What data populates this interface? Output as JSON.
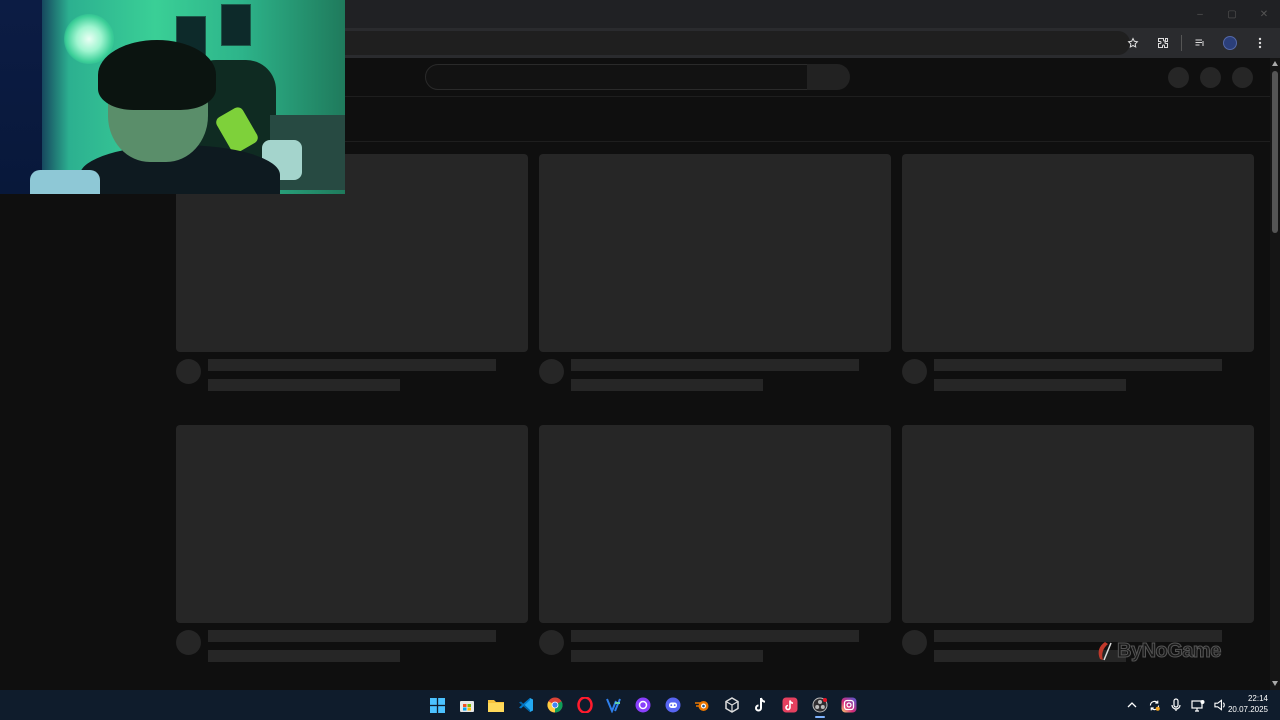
{
  "browser": {
    "window_controls": {
      "minimize": "–",
      "maximize": "▢",
      "close": "✕"
    },
    "toolbar_icons": [
      "star-icon",
      "extensions-icon",
      "media-controls-icon",
      "profile-icon",
      "more-menu-icon"
    ]
  },
  "youtube": {
    "state": "loading-skeleton"
  },
  "watermark": {
    "text": "ByNoGame"
  },
  "taskbar": {
    "apps": [
      "windows-start-icon",
      "microsoft-store-icon",
      "file-explorer-icon",
      "vscode-icon",
      "chrome-icon",
      "opera-icon",
      "vscodium-icon",
      "arc-browser-icon",
      "discord-icon",
      "blender-icon",
      "unity-icon",
      "tiktok-icon",
      "tiktok-app-icon",
      "obs-icon",
      "instagram-icon"
    ],
    "active_app": "obs-icon",
    "tray": [
      "chevron-up-icon",
      "sync-icon",
      "microphone-icon",
      "network-icon",
      "volume-icon"
    ],
    "clock": {
      "time": "22:14",
      "date": "20.07.2025"
    }
  },
  "colors": {
    "page_bg": "#0f0f0f",
    "skeleton": "#262626",
    "taskbar_bg": "#0f1c2c",
    "accent": "#7fb3ff"
  }
}
